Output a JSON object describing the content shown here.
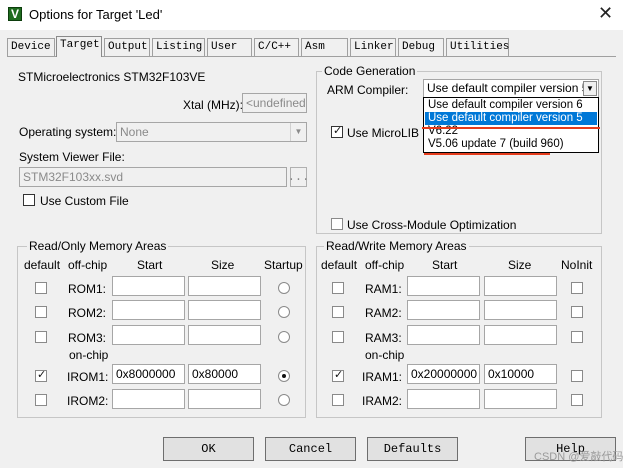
{
  "window": {
    "title": "Options for Target 'Led'",
    "icon_letter": "V",
    "close_glyph": "✕"
  },
  "tabs": [
    {
      "label": "Device"
    },
    {
      "label": "Target"
    },
    {
      "label": "Output"
    },
    {
      "label": "Listing"
    },
    {
      "label": "User"
    },
    {
      "label": "C/C++"
    },
    {
      "label": "Asm"
    },
    {
      "label": "Linker"
    },
    {
      "label": "Debug"
    },
    {
      "label": "Utilities"
    }
  ],
  "active_tab": "Target",
  "device": {
    "name": "STMicroelectronics STM32F103VE",
    "xtal_label": "Xtal (MHz):",
    "xtal_value": "<undefined>",
    "os_label": "Operating system:",
    "os_value": "None",
    "svf_label": "System Viewer File:",
    "svf_value": "STM32F103xx.svd",
    "browse_label": "...",
    "use_custom_file": "Use Custom File"
  },
  "code_generation": {
    "group_title": "Code Generation",
    "arm_compiler_label": "ARM Compiler:",
    "arm_compiler_value": "Use default compiler version 5",
    "dropdown_options": [
      "Use default compiler version 6",
      "Use default compiler version 5",
      "V6.22",
      "V5.06 update 7 (build 960)"
    ],
    "selected_option_index": 1,
    "use_microlib": "Use MicroLIB",
    "use_microlib_checked": true,
    "cross_module": "Use Cross-Module Optimization",
    "cross_module_checked": false
  },
  "ro_memory": {
    "group_title": "Read/Only Memory Areas",
    "headers": {
      "default": "default",
      "offchip": "off-chip",
      "start": "Start",
      "size": "Size",
      "startup": "Startup"
    },
    "onchip_label": "on-chip",
    "rows": [
      {
        "name": "ROM1:",
        "start": "",
        "size": "",
        "default": false,
        "startup": false
      },
      {
        "name": "ROM2:",
        "start": "",
        "size": "",
        "default": false,
        "startup": false
      },
      {
        "name": "ROM3:",
        "start": "",
        "size": "",
        "default": false,
        "startup": false
      },
      {
        "name": "IROM1:",
        "start": "0x8000000",
        "size": "0x80000",
        "default": true,
        "startup": true
      },
      {
        "name": "IROM2:",
        "start": "",
        "size": "",
        "default": false,
        "startup": false
      }
    ]
  },
  "rw_memory": {
    "group_title": "Read/Write Memory Areas",
    "headers": {
      "default": "default",
      "offchip": "off-chip",
      "start": "Start",
      "size": "Size",
      "noinit": "NoInit"
    },
    "onchip_label": "on-chip",
    "rows": [
      {
        "name": "RAM1:",
        "start": "",
        "size": "",
        "default": false,
        "noinit": false
      },
      {
        "name": "RAM2:",
        "start": "",
        "size": "",
        "default": false,
        "noinit": false
      },
      {
        "name": "RAM3:",
        "start": "",
        "size": "",
        "default": false,
        "noinit": false
      },
      {
        "name": "IRAM1:",
        "start": "0x20000000",
        "size": "0x10000",
        "default": true,
        "noinit": false
      },
      {
        "name": "IRAM2:",
        "start": "",
        "size": "",
        "default": false,
        "noinit": false
      }
    ]
  },
  "buttons": {
    "ok": "OK",
    "cancel": "Cancel",
    "defaults": "Defaults",
    "help": "Help"
  },
  "watermark": "CSDN @爱敲代码的",
  "colors": {
    "selection": "#0078d7",
    "annotation": "#e53c1c"
  }
}
